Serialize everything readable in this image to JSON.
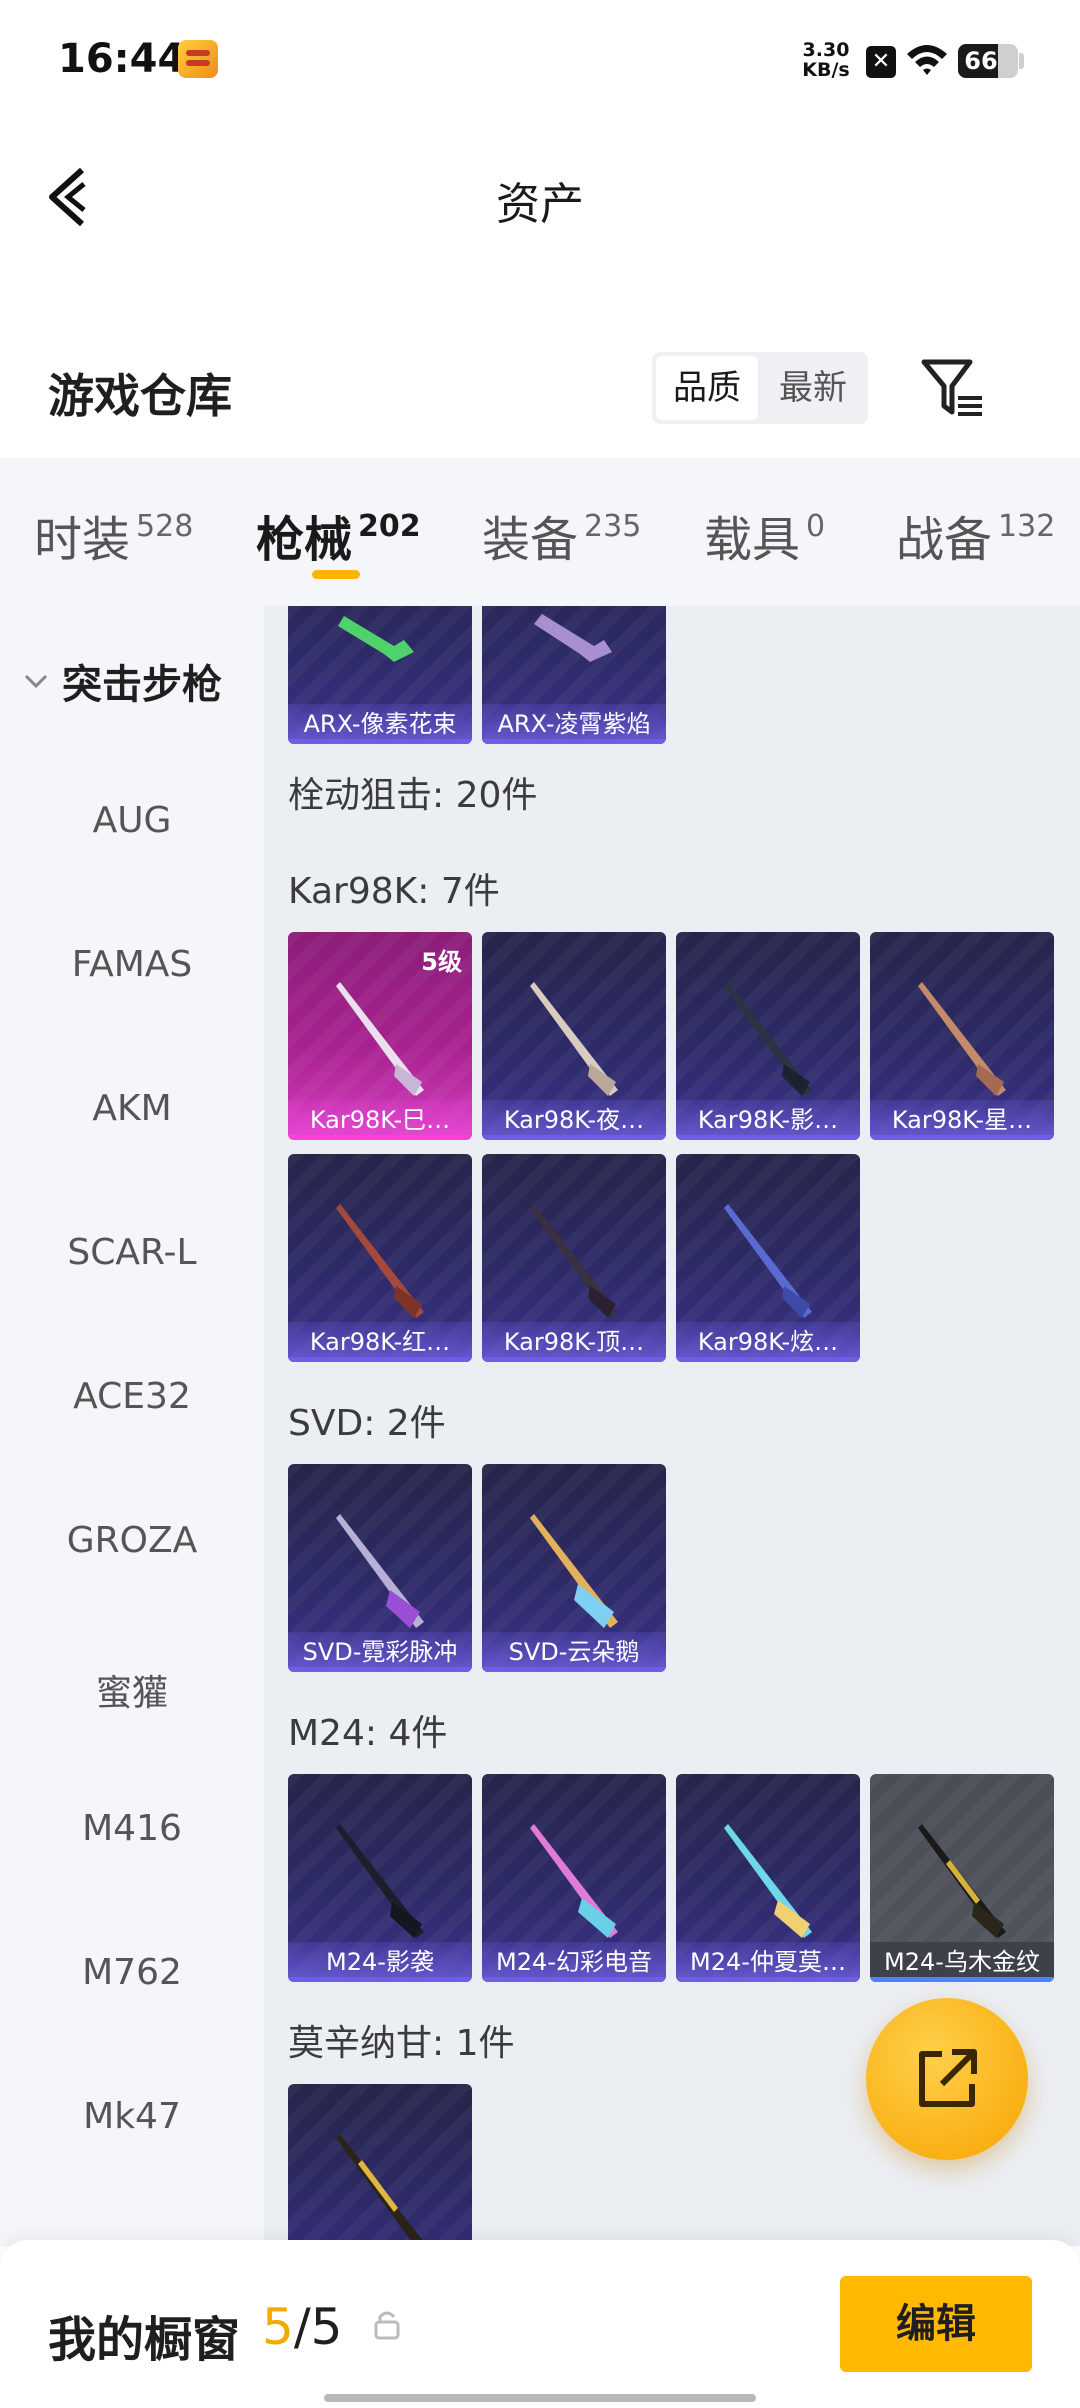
{
  "status_bar": {
    "time": "16:44",
    "net_speed": "3.30",
    "net_unit": "KB/s",
    "sim": "✕",
    "battery": "66",
    "battery_fraction": 0.66
  },
  "header": {
    "title": "资产"
  },
  "section": {
    "title": "游戏仓库",
    "sort_options": [
      "品质",
      "最新"
    ]
  },
  "tabs": [
    {
      "label": "时装",
      "count": "528"
    },
    {
      "label": "枪械",
      "count": "202"
    },
    {
      "label": "装备",
      "count": "235"
    },
    {
      "label": "载具",
      "count": "0"
    },
    {
      "label": "战备",
      "count": "132"
    }
  ],
  "sidebar": {
    "group": "突击步枪",
    "items": [
      "AUG",
      "FAMAS",
      "AKM",
      "SCAR-L",
      "ACE32",
      "GROZA",
      "蜜獾",
      "M416",
      "M762",
      "Mk47"
    ]
  },
  "content": {
    "top_cards": [
      "ARX-像素花束",
      "ARX-凌霄紫焰"
    ],
    "groups": [
      {
        "label": "栓动狙击: 20件"
      },
      {
        "label": "Kar98K: 7件"
      },
      {
        "label": "SVD: 2件"
      },
      {
        "label": "M24: 4件"
      },
      {
        "label": "莫辛纳甘: 1件"
      }
    ],
    "kar98k_cards": [
      "Kar98K-巳…",
      "Kar98K-夜…",
      "Kar98K-影…",
      "Kar98K-星…",
      "Kar98K-红…",
      "Kar98K-顶…",
      "Kar98K-炫…"
    ],
    "kar98k_level": "5级",
    "svd_cards": [
      "SVD-霓彩脉冲",
      "SVD-云朵鹅"
    ],
    "m24_cards": [
      "M24-影袭",
      "M24-幻彩电音",
      "M24-仲夏莫…",
      "M24-乌木金纹"
    ]
  },
  "bottom": {
    "label": "我的橱窗",
    "current": "5",
    "separator": "/",
    "total": "5",
    "edit_label": "编辑"
  },
  "colors": {
    "accent": "#ffb400",
    "legendary": "#d33cc0",
    "epic": "#6c5ee6"
  },
  "icons": [
    "back-arrow-icon",
    "filter-icon",
    "chevron-down-icon",
    "share-icon",
    "lock-icon",
    "wifi-icon"
  ]
}
